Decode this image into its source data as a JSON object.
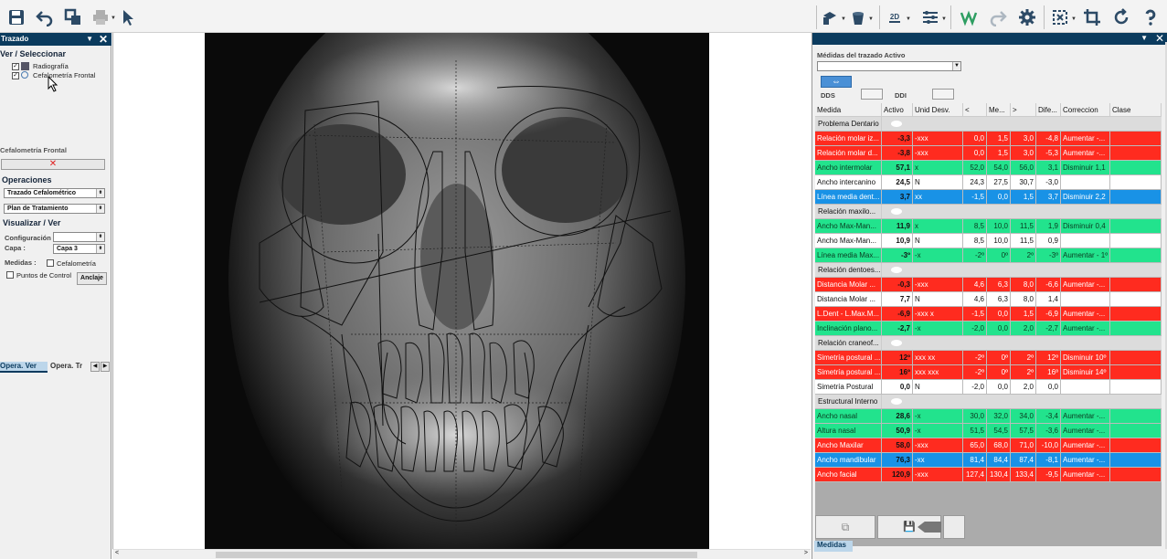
{
  "left_panel": {
    "title": "Trazado",
    "view_select_heading": "Ver / Seleccionar",
    "tree": [
      {
        "label": "Radiografía",
        "checked": true
      },
      {
        "label": "Cefalometría Frontal",
        "checked": true
      }
    ],
    "cef_label": "Cefalometría Frontal",
    "operaciones_heading": "Operaciones",
    "combo1": "Trazado Cefalométrico",
    "combo2": "Plan de Tratamiento",
    "visualizar_heading": "Visualizar / Ver",
    "config_label": "Configuración",
    "capa_label": "Capa :",
    "capa_value": "Capa 3",
    "medidas_label": "Medidas :",
    "cefalometria_chk": "Cefalometría",
    "puntos_chk": "Puntos de Control",
    "anclaje_btn": "Anclaje",
    "tab1": "Opera. Ver",
    "tab2": "Opera. Tr"
  },
  "toolbar": {
    "zoom_label": "2D"
  },
  "right_panel": {
    "medidas_trazado_label": "Médidas del trazado Activo",
    "dds_label": "DDS",
    "ddi_label": "DDI",
    "bottom_tab": "Medidas",
    "headers": [
      "Medida",
      "Activo",
      "Unid Desv.",
      "<",
      "Me...",
      ">",
      "Dife...",
      "Correccion",
      "Clase"
    ],
    "rows": [
      {
        "type": "group",
        "cells": [
          "Problema Dentario"
        ]
      },
      {
        "type": "red",
        "cells": [
          "Relación molar iz...",
          "-3,3",
          "-xxx",
          "0,0",
          "1,5",
          "3,0",
          "-4,8",
          "Aumentar -...",
          ""
        ]
      },
      {
        "type": "red",
        "cells": [
          "Relación molar d...",
          "-3,8",
          "-xxx",
          "0,0",
          "1,5",
          "3,0",
          "-5,3",
          "Aumentar -...",
          ""
        ]
      },
      {
        "type": "green",
        "cells": [
          "Ancho intermolar",
          "57,1",
          "x",
          "52,0",
          "54,0",
          "56,0",
          "3,1",
          "Disminuir 1,1",
          ""
        ]
      },
      {
        "type": "white",
        "cells": [
          "Ancho intercanino",
          "24,5",
          "N",
          "24,3",
          "27,5",
          "30,7",
          "-3,0",
          "",
          ""
        ]
      },
      {
        "type": "blue",
        "cells": [
          "Línea media dent...",
          "3,7",
          "xx",
          "-1,5",
          "0,0",
          "1,5",
          "3,7",
          "Disminuir 2,2",
          ""
        ]
      },
      {
        "type": "group",
        "cells": [
          "Relación maxilo..."
        ]
      },
      {
        "type": "green",
        "cells": [
          "Ancho Max-Man...",
          "11,9",
          "x",
          "8,5",
          "10,0",
          "11,5",
          "1,9",
          "Disminuir 0,4",
          ""
        ]
      },
      {
        "type": "white",
        "cells": [
          "Ancho Max-Man...",
          "10,9",
          "N",
          "8,5",
          "10,0",
          "11,5",
          "0,9",
          "",
          ""
        ]
      },
      {
        "type": "green",
        "cells": [
          "Línea media Max...",
          "-3º",
          "-x",
          "-2º",
          "0º",
          "2º",
          "-3º",
          "Aumentar - 1º",
          ""
        ]
      },
      {
        "type": "group",
        "cells": [
          "Relación dentoes..."
        ]
      },
      {
        "type": "red",
        "cells": [
          "Distancia Molar ...",
          "-0,3",
          "-xxx",
          "4,6",
          "6,3",
          "8,0",
          "-6,6",
          "Aumentar -...",
          ""
        ]
      },
      {
        "type": "white",
        "cells": [
          "Distancia Molar ...",
          "7,7",
          "N",
          "4,6",
          "6,3",
          "8,0",
          "1,4",
          "",
          ""
        ]
      },
      {
        "type": "red",
        "cells": [
          "L.Dent - L.Max.M...",
          "-6,9",
          "-xxx x",
          "-1,5",
          "0,0",
          "1,5",
          "-6,9",
          "Aumentar -...",
          ""
        ]
      },
      {
        "type": "green",
        "cells": [
          "Inclinación plano...",
          "-2,7",
          "-x",
          "-2,0",
          "0,0",
          "2,0",
          "-2,7",
          "Aumentar -...",
          ""
        ]
      },
      {
        "type": "group",
        "cells": [
          "Relación craneof..."
        ]
      },
      {
        "type": "red",
        "cells": [
          "Simetría postural ...",
          "12º",
          "xxx xx",
          "-2º",
          "0º",
          "2º",
          "12º",
          "Disminuir 10º",
          ""
        ]
      },
      {
        "type": "red",
        "cells": [
          "Simetría postural ...",
          "16º",
          "xxx xxx",
          "-2º",
          "0º",
          "2º",
          "16º",
          "Disminuir 14º",
          ""
        ]
      },
      {
        "type": "white",
        "cells": [
          "Simetría Postural",
          "0,0",
          "N",
          "-2,0",
          "0,0",
          "2,0",
          "0,0",
          "",
          ""
        ]
      },
      {
        "type": "group",
        "cells": [
          "Estructural Interno"
        ]
      },
      {
        "type": "green",
        "cells": [
          "Ancho nasal",
          "28,6",
          "-x",
          "30,0",
          "32,0",
          "34,0",
          "-3,4",
          "Aumentar -...",
          ""
        ]
      },
      {
        "type": "green",
        "cells": [
          "Altura nasal",
          "50,9",
          "-x",
          "51,5",
          "54,5",
          "57,5",
          "-3,6",
          "Aumentar -...",
          ""
        ]
      },
      {
        "type": "red",
        "cells": [
          "Ancho Maxilar",
          "58,0",
          "-xxx",
          "65,0",
          "68,0",
          "71,0",
          "-10,0",
          "Aumentar -...",
          ""
        ]
      },
      {
        "type": "blue",
        "cells": [
          "Ancho mandibular",
          "76,3",
          "-xx",
          "81,4",
          "84,4",
          "87,4",
          "-8,1",
          "Aumentar -...",
          ""
        ]
      },
      {
        "type": "red",
        "cells": [
          "Ancho facial",
          "120,9",
          "-xxx",
          "127,4",
          "130,4",
          "133,4",
          "-9,5",
          "Aumentar -...",
          ""
        ]
      }
    ]
  }
}
